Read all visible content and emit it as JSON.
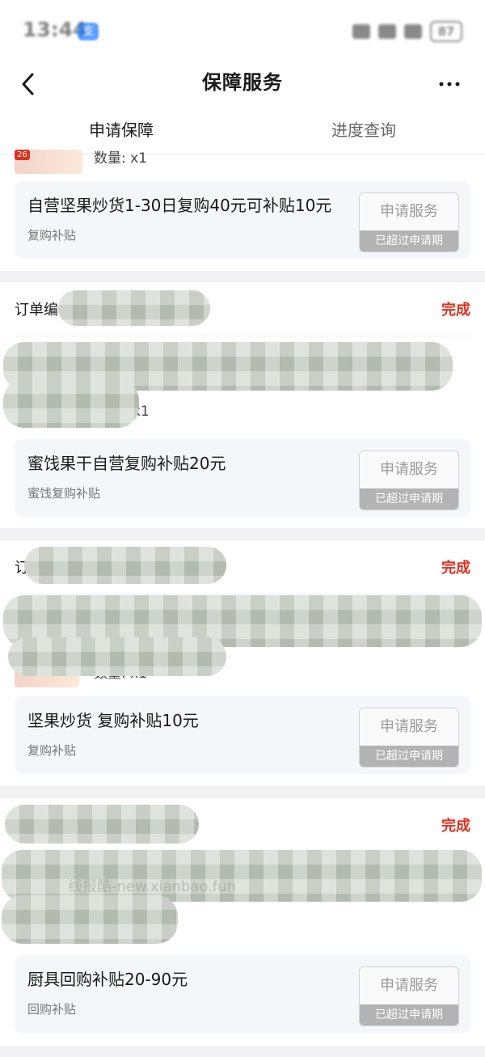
{
  "status_bar": {
    "time": "13:44",
    "app_badge": "支",
    "battery": "87"
  },
  "nav": {
    "title": "保障服务",
    "more_label": "···"
  },
  "tabs": [
    {
      "label": "申请保障"
    },
    {
      "label": "进度查询"
    }
  ],
  "orders": [
    {
      "order_label": "",
      "status": "",
      "qty": "数量: x1",
      "thumb_tag": "26",
      "benefit_title": "自营坚果炒货1-30日复购40元可补贴10元",
      "benefit_sub": "复购补贴",
      "apply_label": "申请服务",
      "expired_label": "已超过申请期"
    },
    {
      "order_label": "订单编",
      "status": "完成",
      "qty": "x1",
      "benefit_title": "蜜饯果干自营复购补贴20元",
      "benefit_sub": "蜜饯复购补贴",
      "apply_label": "申请服务",
      "expired_label": "已超过申请期"
    },
    {
      "order_label": "订",
      "status": "完成",
      "qty": "数量: x1",
      "benefit_title": "坚果炒货 复购补贴10元",
      "benefit_sub": "复购补贴",
      "apply_label": "申请服务",
      "expired_label": "已超过申请期"
    },
    {
      "order_label": "",
      "status": "完成",
      "qty": "",
      "benefit_title": "厨具回购补贴20-90元",
      "benefit_sub": "回购补贴",
      "apply_label": "申请服务",
      "expired_label": "已超过申请期"
    }
  ],
  "watermark": "线报酷-new.xianbao.fun",
  "colors": {
    "status_done": "#e0301e",
    "expired_bg": "#b3b3b3",
    "benefit_bg": "#f5f6fa"
  }
}
